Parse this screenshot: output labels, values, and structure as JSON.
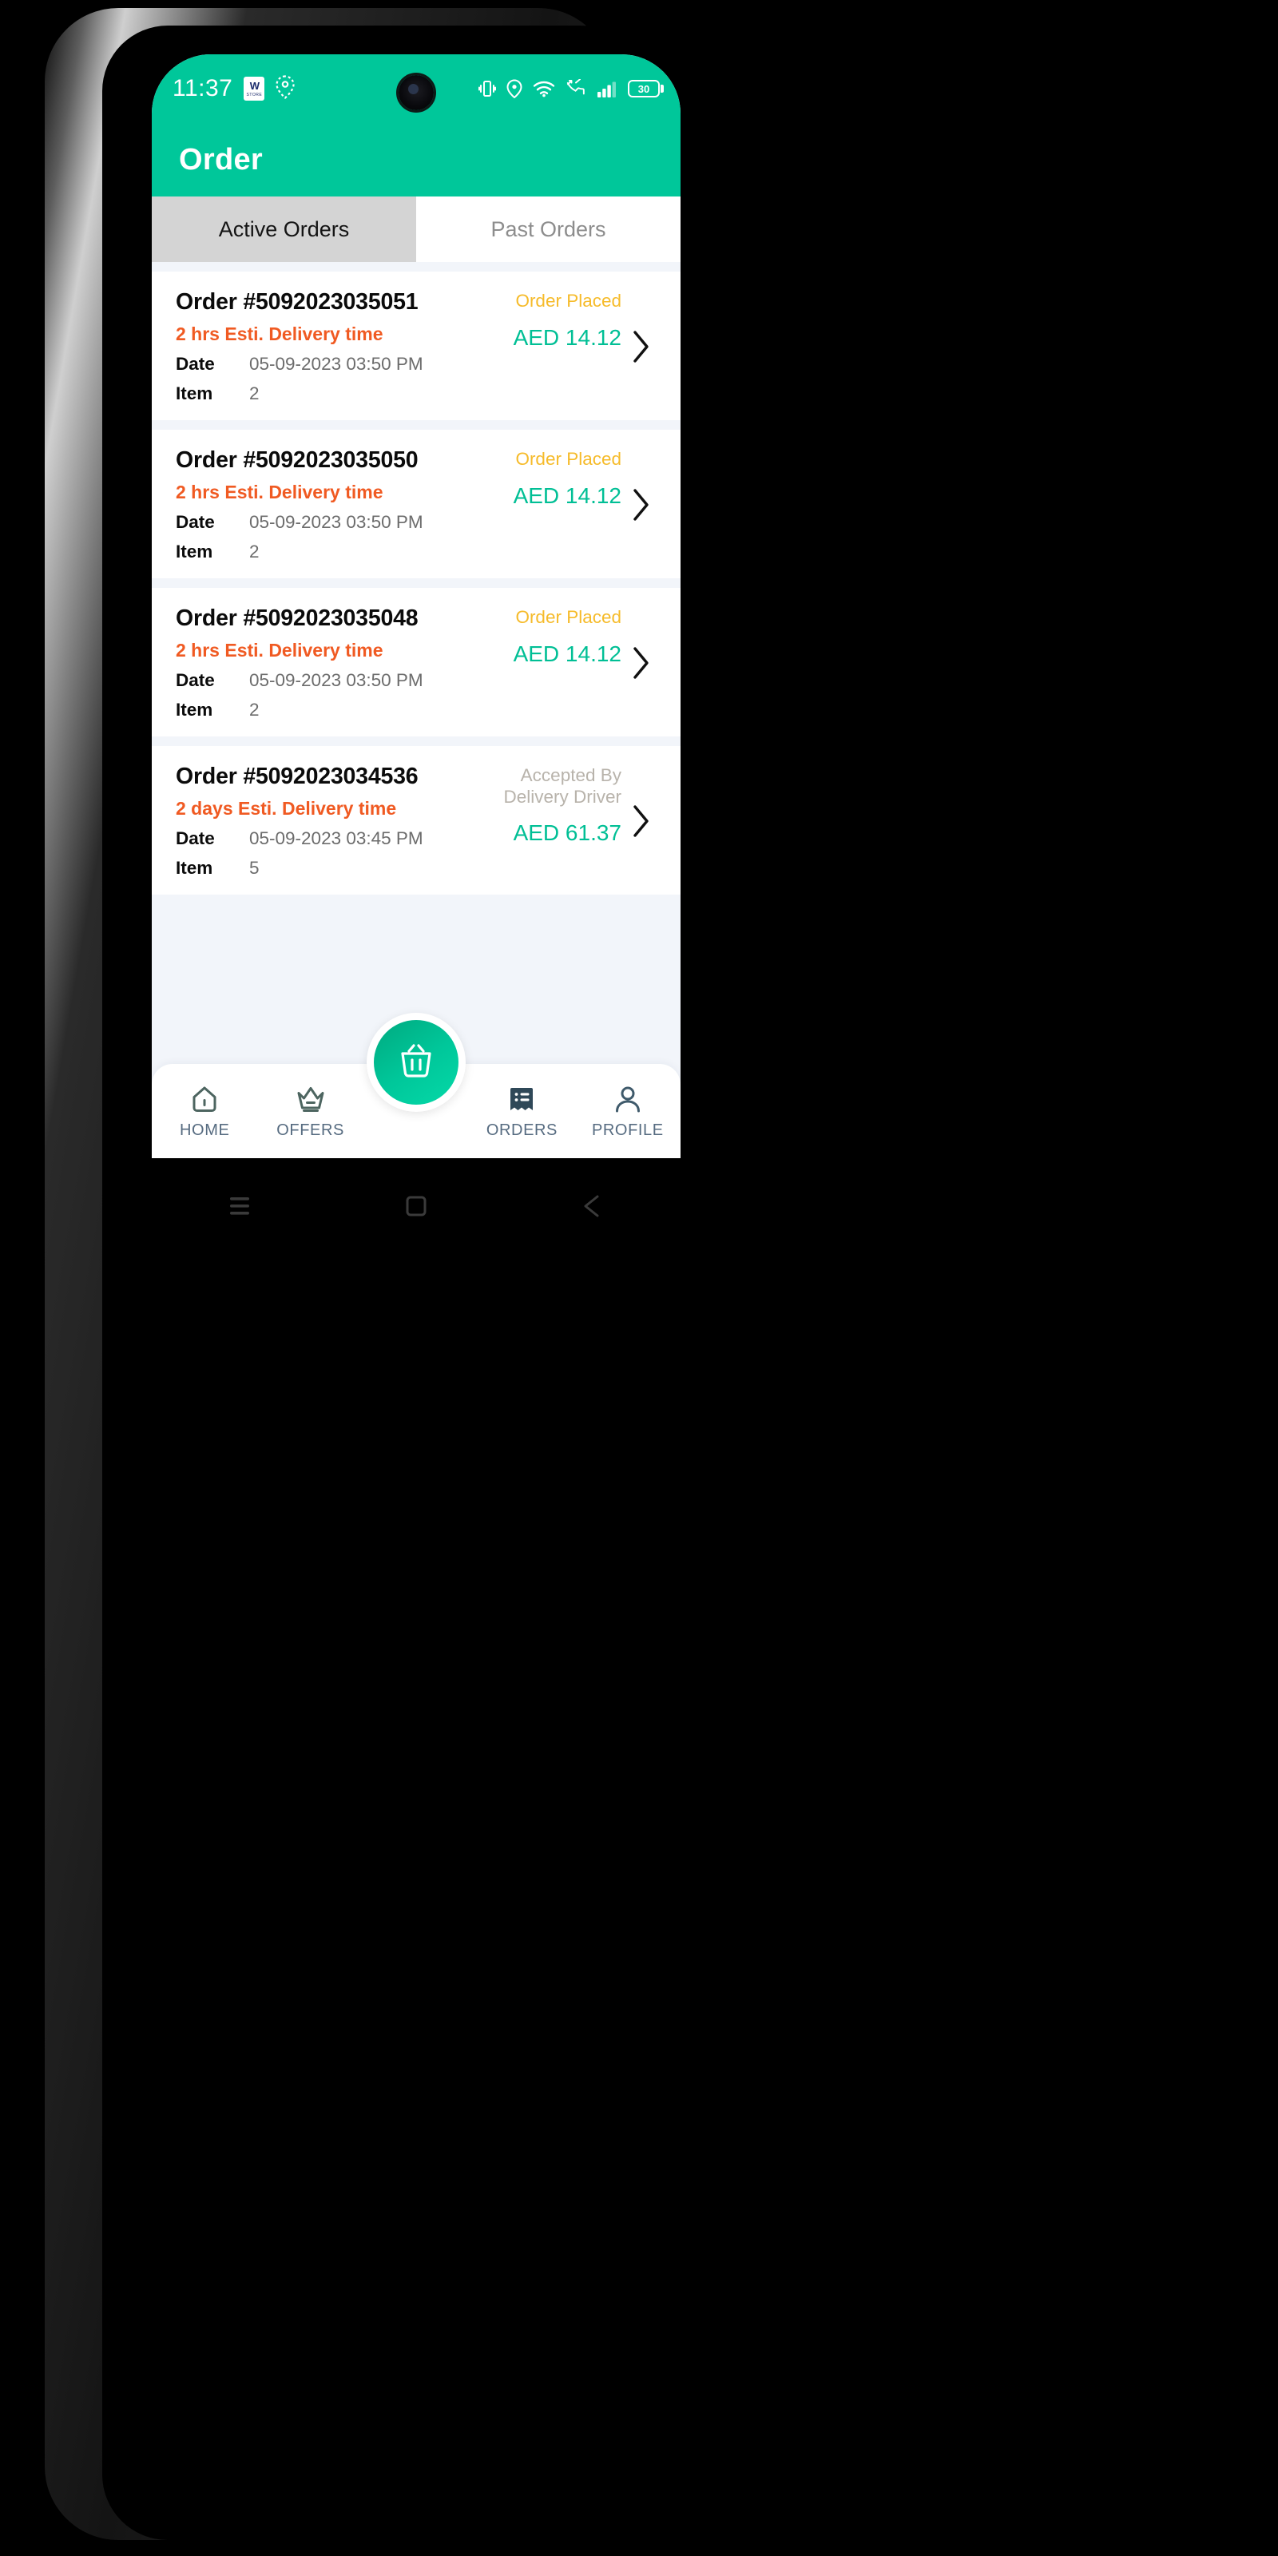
{
  "status_bar": {
    "time": "11:37",
    "app_badge_mark": "W",
    "app_badge_sub": "STORE",
    "battery_percent": "30",
    "icons": [
      "app-badge-icon",
      "location-pin-icon",
      "vibrate-icon",
      "location-icon",
      "wifi-icon",
      "missed-call-icon",
      "signal-bars-icon",
      "battery-icon"
    ]
  },
  "appbar": {
    "title": "Order"
  },
  "tabs": [
    {
      "label": "Active Orders",
      "active": true
    },
    {
      "label": "Past Orders",
      "active": false
    }
  ],
  "orders": [
    {
      "order_no": "Order #5092023035051",
      "eta": "2 hrs Esti. Delivery time",
      "date_label": "Date",
      "date_value": "05-09-2023 03:50 PM",
      "item_label": "Item",
      "item_value": "2",
      "status": "Order Placed",
      "status_kind": "placed",
      "price": "AED 14.12"
    },
    {
      "order_no": "Order #5092023035050",
      "eta": "2 hrs Esti. Delivery time",
      "date_label": "Date",
      "date_value": "05-09-2023 03:50 PM",
      "item_label": "Item",
      "item_value": "2",
      "status": "Order Placed",
      "status_kind": "placed",
      "price": "AED 14.12"
    },
    {
      "order_no": "Order #5092023035048",
      "eta": "2 hrs Esti. Delivery time",
      "date_label": "Date",
      "date_value": "05-09-2023 03:50 PM",
      "item_label": "Item",
      "item_value": "2",
      "status": "Order Placed",
      "status_kind": "placed",
      "price": "AED 14.12"
    },
    {
      "order_no": "Order #5092023034536",
      "eta": "2 days Esti. Delivery time",
      "date_label": "Date",
      "date_value": "05-09-2023 03:45 PM",
      "item_label": "Item",
      "item_value": "5",
      "status": "Accepted By Delivery Driver",
      "status_kind": "accepted",
      "price": "AED 61.37"
    }
  ],
  "bottom_nav": {
    "items": [
      {
        "label": "HOME",
        "icon": "home-icon"
      },
      {
        "label": "OFFERS",
        "icon": "crown-icon"
      },
      {
        "label": "ORDERS",
        "icon": "receipt-list-icon"
      },
      {
        "label": "PROFILE",
        "icon": "person-icon"
      }
    ],
    "fab_icon": "shopping-basket-icon"
  },
  "system_nav": {
    "buttons": [
      "recents-menu-icon",
      "home-square-icon",
      "back-triangle-icon"
    ]
  },
  "colors": {
    "brand_teal": "#00c79a",
    "price_teal": "#00bf95",
    "eta_orange": "#f05a22",
    "status_placed": "#f6bb2a",
    "status_accepted": "#b8b3ab",
    "page_bg": "#f2f5fa",
    "tab_active_bg": "#d4d4d4",
    "nav_label": "#566b80"
  }
}
